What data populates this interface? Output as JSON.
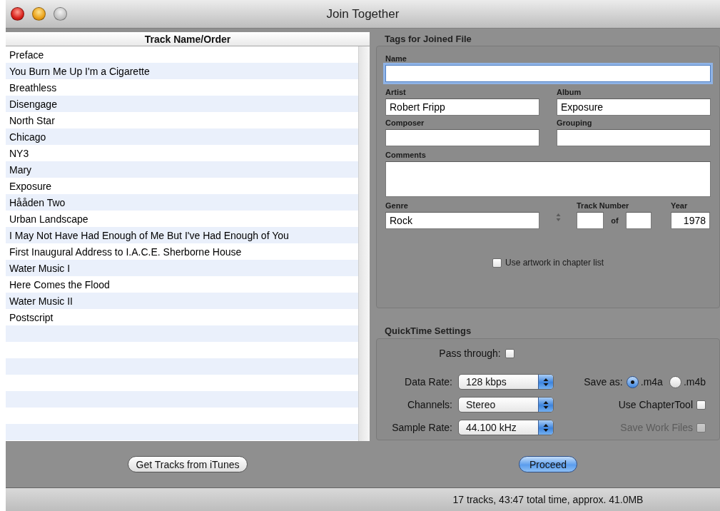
{
  "window": {
    "title": "Join Together",
    "controls": [
      {
        "kind": "close",
        "enabled": true
      },
      {
        "kind": "minimize",
        "enabled": true
      },
      {
        "kind": "zoom",
        "enabled": false
      }
    ]
  },
  "track_list": {
    "column": "Track Name/Order",
    "rows": [
      "Preface",
      "You Burn Me Up I'm a Cigarette",
      "Breathless",
      "Disengage",
      "North Star",
      "Chicago",
      "NY3",
      "Mary",
      "Exposure",
      "Hååden Two",
      "Urban Landscape",
      "I May Not Have Had Enough of Me But I've Had Enough of You",
      "First Inaugural Address to I.A.C.E. Sherborne House",
      "Water Music I",
      "Here Comes the Flood",
      "Water Music II",
      "Postscript"
    ]
  },
  "tags": {
    "title": "Tags for Joined File",
    "name": {
      "label": "Name",
      "focused": true
    },
    "artist": {
      "label": "Artist",
      "value": "Robert Fripp"
    },
    "album": {
      "label": "Album",
      "value": "Exposure"
    },
    "composer": {
      "label": "Composer"
    },
    "grouping": {
      "label": "Grouping"
    },
    "comments": {
      "label": "Comments"
    },
    "genre": {
      "label": "Genre",
      "value": "Rock"
    },
    "track_number": {
      "label": "Track Number",
      "separator": "of"
    },
    "year": {
      "label": "Year",
      "value": "1978"
    },
    "use_artwork": {
      "label": "Use artwork in chapter list",
      "checked": false
    }
  },
  "quicktime": {
    "title": "QuickTime Settings",
    "pass_through": {
      "label": "Pass through:",
      "checked": false
    },
    "popups": [
      {
        "label": "Data Rate:",
        "value": "128 kbps"
      },
      {
        "label": "Channels:",
        "value": "Stereo"
      },
      {
        "label": "Sample Rate:",
        "value": "44.100 kHz"
      }
    ],
    "save_as": {
      "label": "Save as:",
      "options": [
        {
          "label": ".m4a",
          "selected": true
        },
        {
          "label": ".m4b",
          "selected": false
        }
      ]
    },
    "use_chaptertool": {
      "label": "Use ChapterTool",
      "checked": false,
      "disabled": false
    },
    "save_work_files": {
      "label": "Save Work Files",
      "checked": false,
      "disabled": true
    }
  },
  "buttons": [
    {
      "label": "Get Tracks from iTunes",
      "default": false
    },
    {
      "label": "Proceed",
      "default": true
    }
  ],
  "status_bar": "17 tracks, 43:47 total time, approx. 41.0MB"
}
